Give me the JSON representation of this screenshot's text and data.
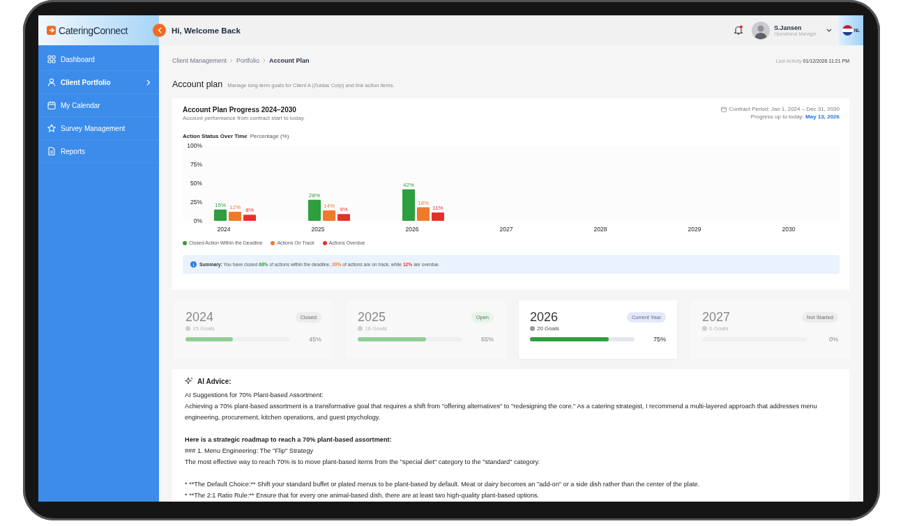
{
  "brand": "CateringConnect",
  "sidebar": {
    "items": [
      {
        "label": "Dashboard",
        "selected": false,
        "has_submenu": false
      },
      {
        "label": "Client Portfolio",
        "selected": true,
        "has_submenu": true
      },
      {
        "label": "My Calendar",
        "selected": false,
        "has_submenu": false
      },
      {
        "label": "Survey Management",
        "selected": false,
        "has_submenu": false
      },
      {
        "label": "Reports",
        "selected": false,
        "has_submenu": false
      }
    ]
  },
  "header": {
    "greeting": "Hi, Welcome Back",
    "user": {
      "name": "S.Jansen",
      "role": "Operational Manager"
    },
    "language": "NL"
  },
  "breadcrumbs": [
    "Client Management",
    "Portfolio",
    "Account Plan"
  ],
  "last_activity": {
    "label": "Last Activity",
    "value": "01/12/2026 11:21 PM"
  },
  "page": {
    "title": "Account plan",
    "subtitle": "Manage long-term goals for Client A (Zuidas Corp) and link action items."
  },
  "progress_card": {
    "title": "Account Plan Progress 2024–2030",
    "subtitle": "Account performance from contract start to today.",
    "contract_period": "Contract Period: Jan 1, 2024 – Dec 31, 2030",
    "progress_label": "Progress up to today:",
    "progress_date": "May 13, 2026",
    "chart_data": {
      "type": "bar",
      "title": "Action Status Over Time",
      "ylabel": "Percentage (%)",
      "categories": [
        "2024",
        "2025",
        "2026",
        "2027",
        "2028",
        "2029",
        "2030"
      ],
      "series": [
        {
          "name": "Closed Action Within the Deadline",
          "color": "#2e9e3e",
          "values": [
            15,
            28,
            42,
            null,
            null,
            null,
            null
          ],
          "value_labels": [
            "15%",
            "28%",
            "42%",
            null,
            null,
            null,
            null
          ]
        },
        {
          "name": "Actions On Track",
          "color": "#ee7a2c",
          "values": [
            12,
            14,
            18,
            null,
            null,
            null,
            null
          ],
          "value_labels": [
            "12%",
            "14%",
            "18%",
            null,
            null,
            null,
            null
          ]
        },
        {
          "name": "Actions Overdue",
          "color": "#e8302a",
          "values": [
            8,
            9,
            11,
            null,
            null,
            null,
            null
          ],
          "value_labels": [
            "8%",
            "9%",
            "11%",
            null,
            null,
            null,
            null
          ]
        }
      ],
      "ylim": [
        0,
        100
      ],
      "yticks": [
        {
          "value": 0,
          "label": "0%"
        },
        {
          "value": 25,
          "label": "25%"
        },
        {
          "value": 50,
          "label": "50%"
        },
        {
          "value": 75,
          "label": "75%"
        },
        {
          "value": 100,
          "label": "100%"
        }
      ]
    },
    "summary": {
      "label": "Summary:",
      "parts": [
        {
          "text": "You have closed ",
          "kind": "plain"
        },
        {
          "text": "68%",
          "kind": "good"
        },
        {
          "text": " of actions within the deadline, ",
          "kind": "plain"
        },
        {
          "text": "20%",
          "kind": "warn"
        },
        {
          "text": " of actions are on track, while ",
          "kind": "plain"
        },
        {
          "text": "12%",
          "kind": "bad"
        },
        {
          "text": " are overdue.",
          "kind": "plain"
        }
      ]
    }
  },
  "year_cards": [
    {
      "year": "2024",
      "goals": "15 Goals",
      "status": "Closed",
      "color": "#ececec",
      "level": 0.45,
      "percent": "45%",
      "selected": false
    },
    {
      "year": "2025",
      "goals": "18 Goals",
      "status": "Open",
      "color": "#e4f5e6",
      "level": 0.65,
      "percent": "65%",
      "selected": false
    },
    {
      "year": "2026",
      "goals": "20 Goals",
      "status": "Current Year",
      "color": "#e4e8ff",
      "level": 0.75,
      "percent": "75%",
      "selected": true
    },
    {
      "year": "2027",
      "goals": "0 Goals",
      "status": "Not Started",
      "color": "#ececec",
      "level": 0,
      "percent": "0%",
      "selected": false
    }
  ],
  "ai_advice": {
    "title": "AI Advice:",
    "blocks": [
      [
        {
          "text": "AI Suggestions for 70% Plant-based Assortment:",
          "bold": false
        },
        {
          "text": "Achieving a 70% plant-based assortment is a transformative goal that requires a shift from \"offering alternatives\" to \"redesigning the core.\" As a catering strategist, I recommend a multi-layered approach that addresses menu engineering, procurement, kitchen operations, and guest psychology.",
          "bold": false
        }
      ],
      [
        {
          "text": "Here is a strategic roadmap to reach a 70% plant-based assortment:",
          "bold": true
        },
        {
          "text": "### 1. Menu Engineering: The \"Flip\" Strategy",
          "bold": false
        },
        {
          "text": "The most effective way to reach 70% is to move plant-based items from the \"special diet\" category to the \"standard\" category.",
          "bold": false
        }
      ],
      [
        {
          "text": "*   **The Default Choice:** Shift your standard buffet or plated menus to be plant-based by default. Meat or dairy becomes an \"add-on\" or a side dish rather than the center of the plate.",
          "bold": false
        },
        {
          "text": "*   **The 2:1 Ratio Rule:** Ensure that for every one animal-based dish, there are at least two high-quality plant-based options.",
          "bold": false
        }
      ]
    ]
  }
}
